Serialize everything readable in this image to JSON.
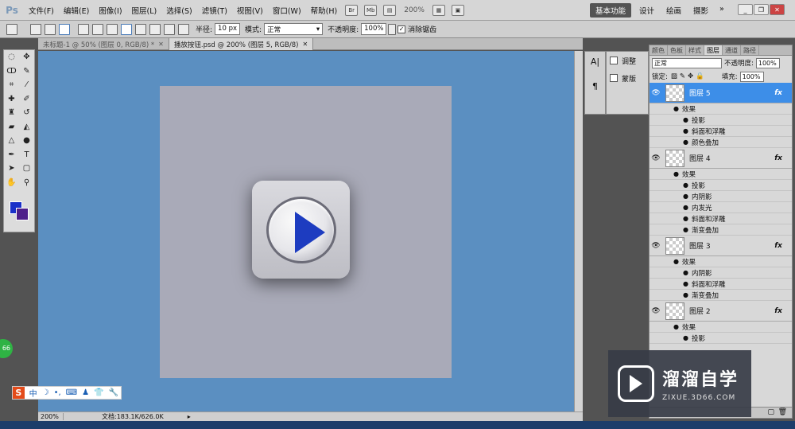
{
  "app": {
    "logo": "Ps"
  },
  "menu": [
    "文件(F)",
    "编辑(E)",
    "图像(I)",
    "图层(L)",
    "选择(S)",
    "滤镜(T)",
    "视图(V)",
    "窗口(W)",
    "帮助(H)"
  ],
  "menubar_icons": {
    "bridge": "Br",
    "minibridge": "Mb"
  },
  "zoom_menu": "200%",
  "workspaces": {
    "active": "基本功能",
    "design": "设计",
    "painting": "绘画",
    "photography": "摄影",
    "more": "»"
  },
  "options": {
    "radius_label": "半径:",
    "radius_value": "10 px",
    "mode_label": "模式:",
    "mode_value": "正常",
    "opacity_label": "不透明度:",
    "opacity_value": "100%",
    "antialias_label": "消除锯齿",
    "antialias_checked": "✓"
  },
  "tabs": [
    {
      "title": "未标题-1 @ 50% (图层 0, RGB/8) *"
    },
    {
      "title": "播放按钮.psd @ 200% (图层 5, RGB/8)"
    }
  ],
  "status": {
    "zoom": "200%",
    "doc": "文档:183.1K/626.0K"
  },
  "ime": {
    "logo": "S",
    "items": [
      "中",
      "☽",
      "•,",
      "⌨",
      "♟",
      "👕",
      "🔧"
    ]
  },
  "badge": "66",
  "adjust_panel": {
    "adjust": "调整",
    "mask": "蒙版"
  },
  "layers_panel": {
    "tabs": [
      "颜色",
      "色板",
      "样式",
      "图层",
      "通道",
      "路径"
    ],
    "active_tab": "图层",
    "blend_mode": "正常",
    "opacity_label": "不透明度:",
    "opacity": "100%",
    "lock_label": "锁定:",
    "fill_label": "填充:",
    "fill": "100%",
    "layers": [
      {
        "name": "图层 5",
        "selected": true,
        "effects_label": "效果",
        "effects": [
          "投影",
          "斜面和浮雕",
          "颜色叠加"
        ]
      },
      {
        "name": "图层 4",
        "selected": false,
        "effects_label": "效果",
        "effects": [
          "投影",
          "内阴影",
          "内发光",
          "斜面和浮雕",
          "渐变叠加"
        ]
      },
      {
        "name": "图层 3",
        "selected": false,
        "effects_label": "效果",
        "effects": [
          "内阴影",
          "斜面和浮雕",
          "渐变叠加"
        ]
      },
      {
        "name": "图层 2",
        "selected": false,
        "effects_label": "效果",
        "effects": [
          "投影"
        ]
      }
    ]
  },
  "watermark": {
    "title": "溜溜自学",
    "url": "ZIXUE.3D66.COM"
  },
  "colors": {
    "canvas_bg": "#5b8fc1",
    "foreground": "#1a30c8",
    "background": "#4d1f8a",
    "selection": "#3d8ee8"
  }
}
